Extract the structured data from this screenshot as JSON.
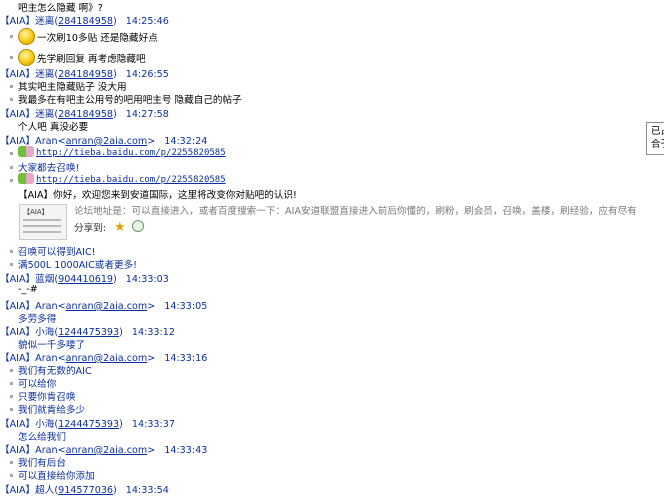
{
  "chat": {
    "line0": "吧主怎么隐藏 啊》?",
    "h1": {
      "nick": "【AIA】迷离",
      "qq": "284184958",
      "time": "14:25:46"
    },
    "m1a": "一次刷10多贴    还是隐藏好点",
    "m1b": "先学刷回复   再考虑隐藏吧",
    "h2": {
      "nick": "【AIA】迷离",
      "qq": "284184958",
      "time": "14:26:55"
    },
    "m2a": "其实吧主隐藏贴子   没大用",
    "m2b": "我最多在有吧主公用号的吧用吧主号   隐藏自己的帖子",
    "h3": {
      "nick": "【AIA】迷离",
      "qq": "284184958",
      "time": "14:27:58"
    },
    "m3a": "个人吧     真没必要",
    "h4": {
      "nick": "【AIA】Aran",
      "qq": "anran@2aia.com",
      "time": "14:32:24"
    },
    "m4a": "http://tieba.baidu.com/p/2255820585",
    "m4b": "大家都去召唤!",
    "m4c": "http://tieba.baidu.com/p/2255820585",
    "card": {
      "title": "【AIA】你好，欢迎您来到安道国际，这里将改变你对贴吧的认识!",
      "thumb": "【AIA】",
      "body": "论坛地址是：可以直接进入，或者百度搜索一下：AIA安道联盟直接进入前后你懂的，刷粉，刷会员，召唤，盖楼，刷经验，应有尽有",
      "share": "分享到:"
    },
    "m4d": "召唤可以得到AIC!",
    "m4e": "满500L 1000AIC或者更多!",
    "h5": {
      "nick": "【AIA】蓝烟",
      "qq": "904410619",
      "time": "14:33:03"
    },
    "m5a": "-_-#",
    "h6": {
      "nick": "【AIA】Aran",
      "qq": "anran@2aia.com",
      "time": "14:33:05"
    },
    "m6a": "多劳多得",
    "h7": {
      "nick": "【AIA】小海",
      "qq": "1244475393",
      "time": "14:33:12"
    },
    "m7a": "貌似一千多喽了",
    "h8": {
      "nick": "【AIA】Aran",
      "qq": "anran@2aia.com",
      "time": "14:33:16"
    },
    "m8a": "我们有无数的AIC",
    "m8b": "可以给你",
    "m8c": "只要你肯召唤",
    "m8d": "我们就肯给多少",
    "h9": {
      "nick": "【AIA】小海",
      "qq": "1244475393",
      "time": "14:33:37"
    },
    "m9a": "怎么给我们",
    "h10": {
      "nick": "【AIA】Aran",
      "qq": "anran@2aia.com",
      "time": "14:33:43"
    },
    "m10a": "我们有后台",
    "m10b": "可以直接给你添加",
    "h11": {
      "nick": "【AIA】超人",
      "qq": "914577036",
      "time": "14:33:54"
    }
  },
  "tooltip": {
    "line1": "已占",
    "line2": "合于"
  },
  "colors": {
    "header": "#0b2f9e",
    "grey": "#7a7a7a"
  }
}
